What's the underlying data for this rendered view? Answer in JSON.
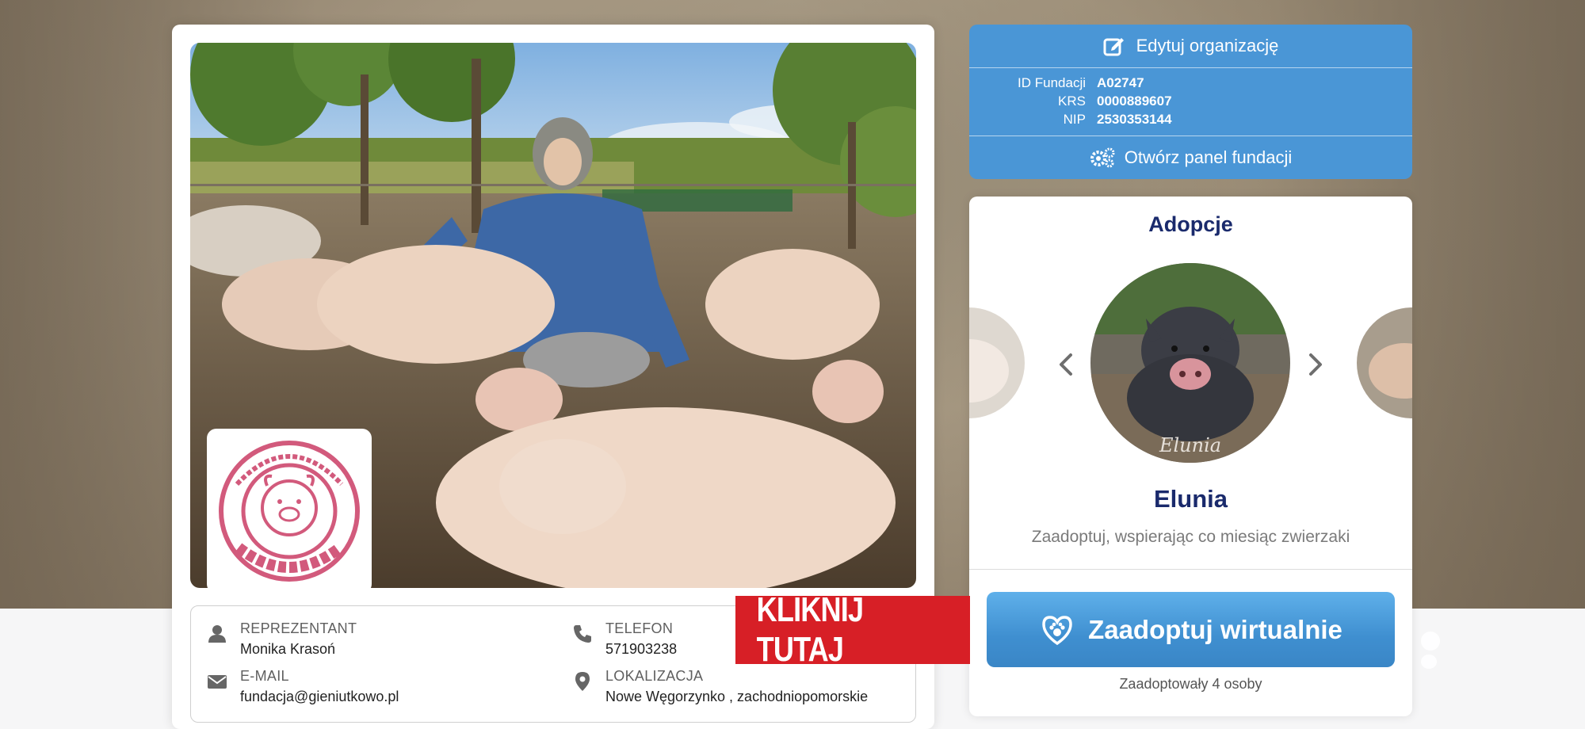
{
  "organization": {
    "edit_label": "Edytuj organizację",
    "details": [
      {
        "key": "ID Fundacji",
        "value": "A02747"
      },
      {
        "key": "KRS",
        "value": "0000889607"
      },
      {
        "key": "NIP",
        "value": "2530353144"
      }
    ],
    "open_panel_label": "Otwórz panel fundacji",
    "logo_text": "FUNDACJA PROSIACZKA EUGENIUSZA GIENIUTKOWO"
  },
  "contact": {
    "representative": {
      "label": "REPREZENTANT",
      "value": "Monika Krasoń",
      "icon": "user-icon"
    },
    "phone": {
      "label": "TELEFON",
      "value": "571903238",
      "icon": "phone-icon"
    },
    "email": {
      "label": "E-MAIL",
      "value": "fundacja@gieniutkowo.pl",
      "icon": "envelope-icon"
    },
    "location": {
      "label": "LOKALIZACJA",
      "value": "Nowe Węgorzynko , zachodniopomorskie",
      "icon": "map-pin-icon"
    }
  },
  "adoptions": {
    "title": "Adopcje",
    "current_pet": {
      "name": "Elunia",
      "image_caption": "Elunia",
      "description": "Zaadoptuj, wspierając co miesiąc zwierzaki"
    },
    "adopt_button_label": "Zaadoptuj wirtualnie",
    "adopt_count_text": "Zaadoptowały 4 osoby"
  },
  "cta": {
    "text": "KLIKNIJ TUTAJ",
    "color": "#d71f26"
  },
  "colors": {
    "panel_blue": "#4a96d6",
    "title_navy": "#1a2a6c",
    "button_blue": "#3f8fd0"
  }
}
